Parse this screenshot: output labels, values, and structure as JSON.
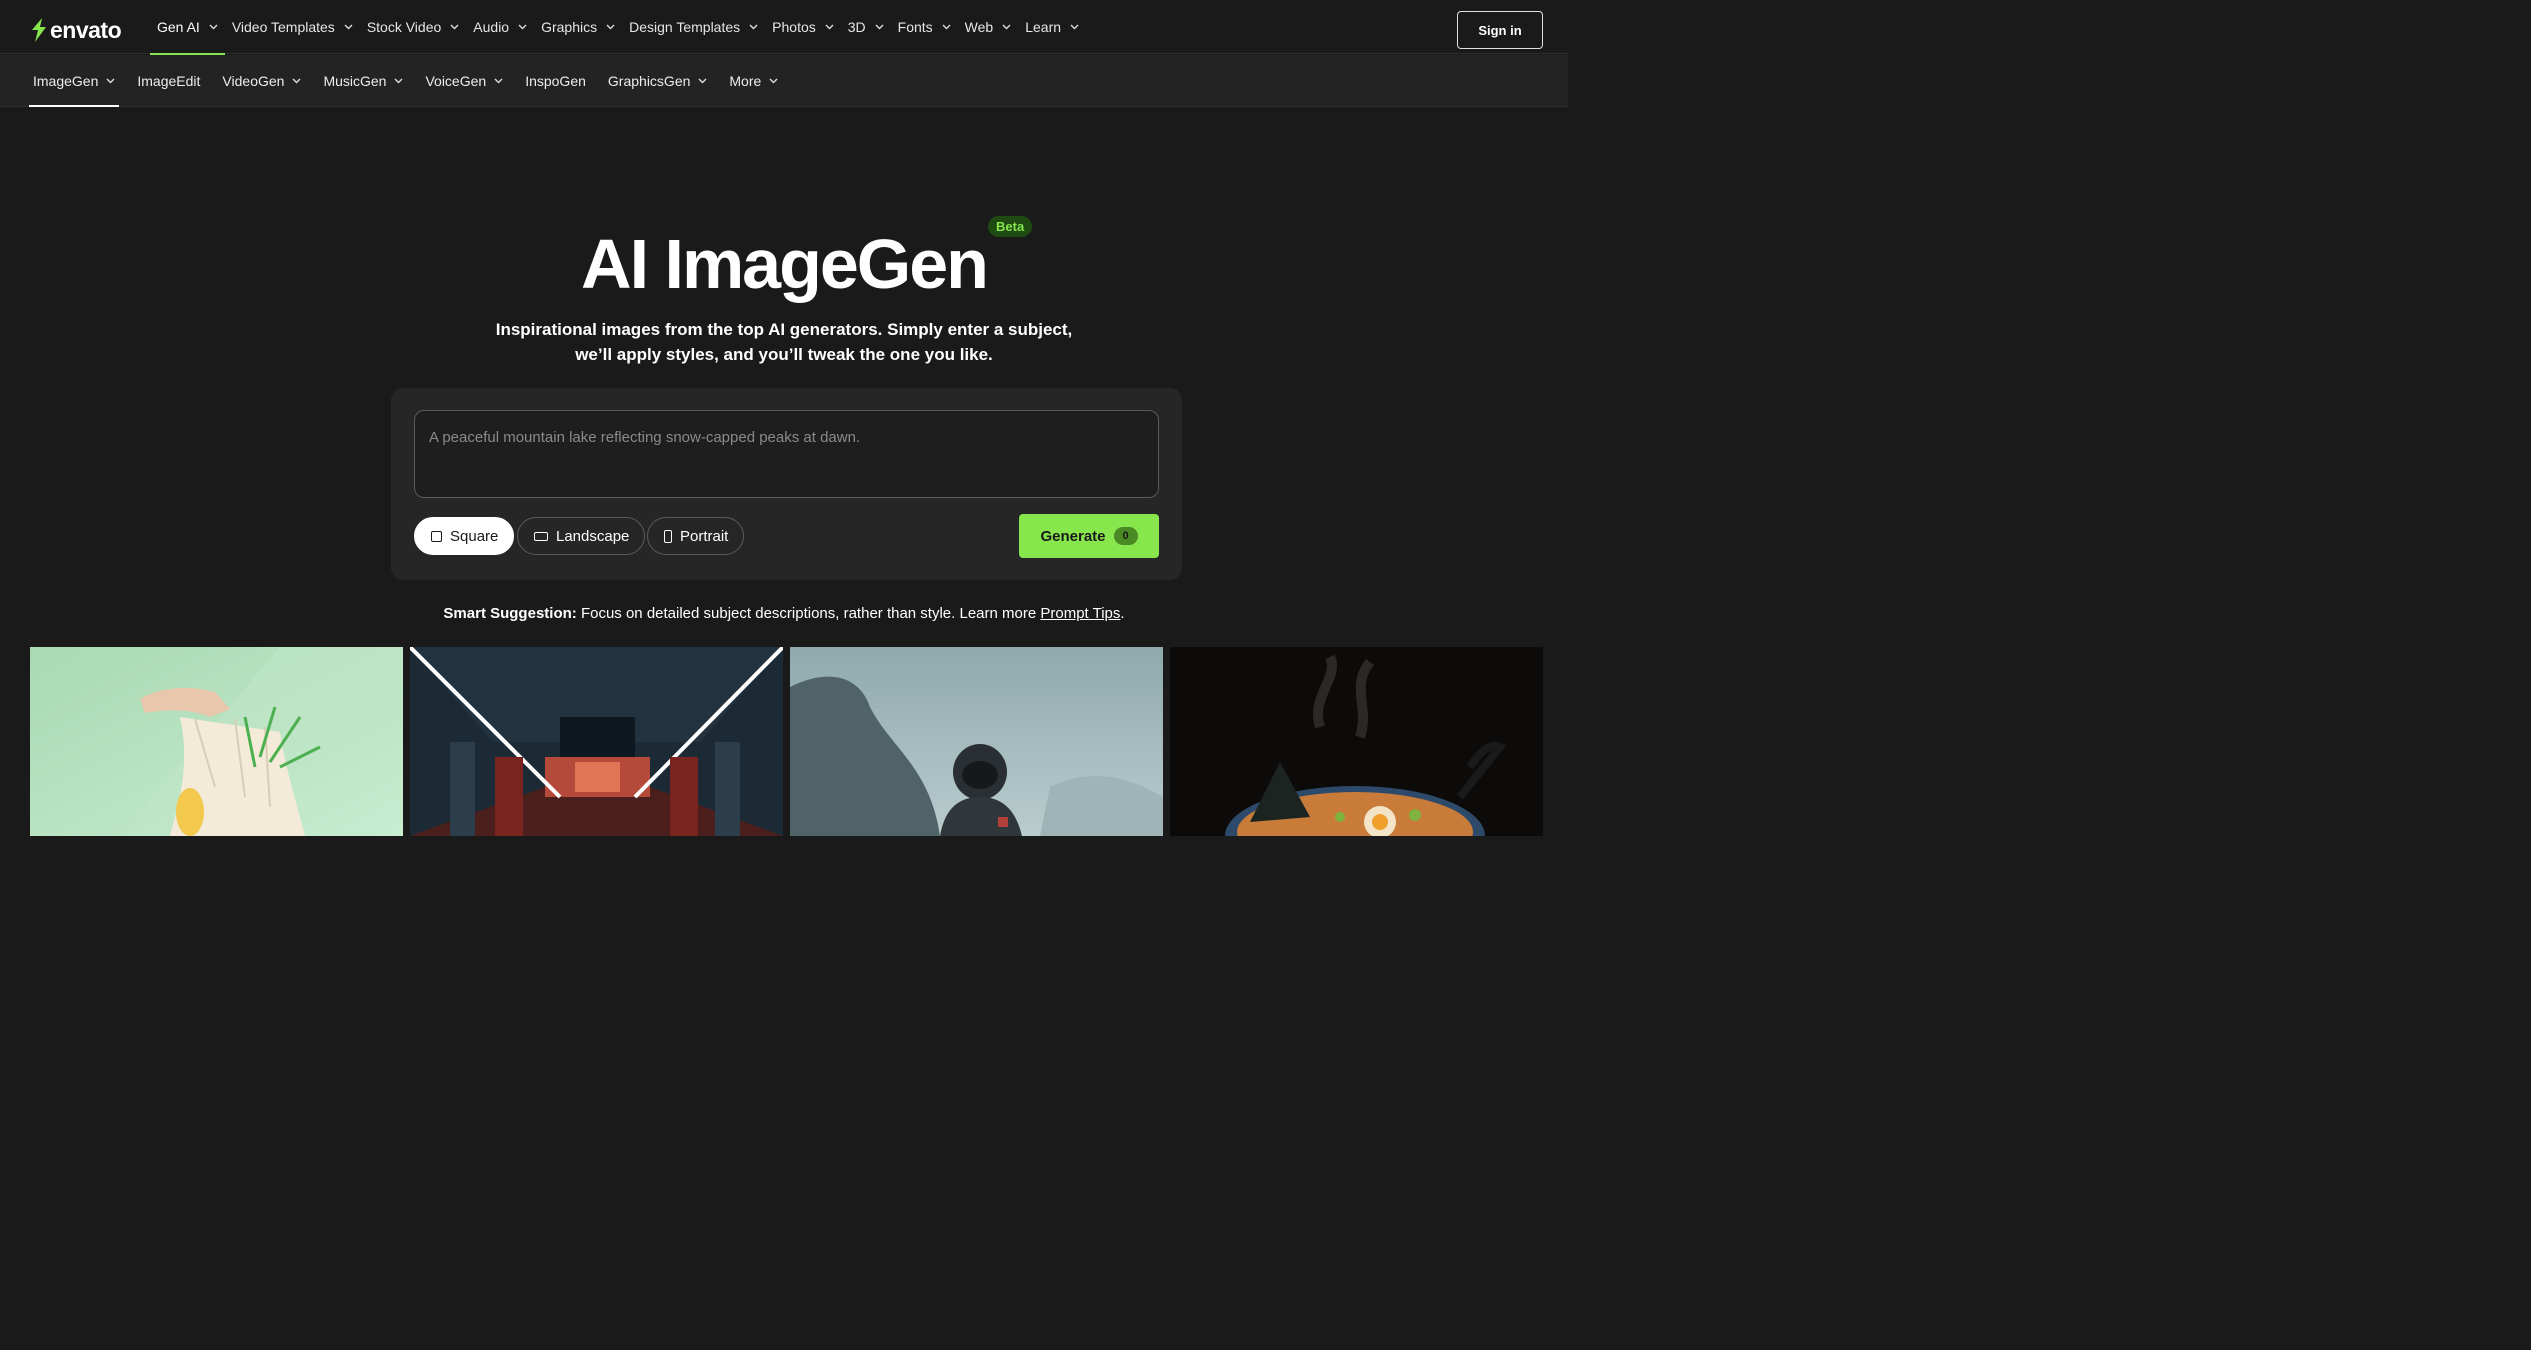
{
  "brand": {
    "name": "envato",
    "accent": "#87e64b"
  },
  "topnav": {
    "items": [
      {
        "label": "Gen AI",
        "active": true
      },
      {
        "label": "Video Templates"
      },
      {
        "label": "Stock Video"
      },
      {
        "label": "Audio"
      },
      {
        "label": "Graphics"
      },
      {
        "label": "Design Templates"
      },
      {
        "label": "Photos"
      },
      {
        "label": "3D"
      },
      {
        "label": "Fonts"
      },
      {
        "label": "Web"
      },
      {
        "label": "Learn"
      }
    ],
    "signin_label": "Sign in"
  },
  "subnav": {
    "items": [
      {
        "label": "ImageGen",
        "active": true,
        "dropdown": true
      },
      {
        "label": "ImageEdit",
        "dropdown": false
      },
      {
        "label": "VideoGen",
        "dropdown": true
      },
      {
        "label": "MusicGen",
        "dropdown": true
      },
      {
        "label": "VoiceGen",
        "dropdown": true
      },
      {
        "label": "InspoGen",
        "dropdown": false
      },
      {
        "label": "GraphicsGen",
        "dropdown": true
      },
      {
        "label": "More",
        "dropdown": true
      }
    ]
  },
  "hero": {
    "title": "AI ImageGen",
    "badge": "Beta",
    "subtitle_line1": "Inspirational images from the top AI generators. Simply enter a subject,",
    "subtitle_line2": "we’ll apply styles, and you’ll tweak the one you like."
  },
  "prompt": {
    "placeholder": "A peaceful mountain lake reflecting snow-capped peaks at dawn.",
    "value": ""
  },
  "ratios": {
    "square": "Square",
    "landscape": "Landscape",
    "portrait": "Portrait",
    "selected": "Square"
  },
  "generate": {
    "label": "Generate",
    "count": "0"
  },
  "suggestion": {
    "lead": "Smart Suggestion:",
    "text": " Focus on detailed subject descriptions, rather than style. Learn more ",
    "link": "Prompt Tips",
    "trail": "."
  },
  "gallery": {
    "items": [
      {
        "name": "gallery-image-grocery-bag"
      },
      {
        "name": "gallery-image-corridor"
      },
      {
        "name": "gallery-image-astronaut"
      },
      {
        "name": "gallery-image-ramen"
      }
    ]
  }
}
